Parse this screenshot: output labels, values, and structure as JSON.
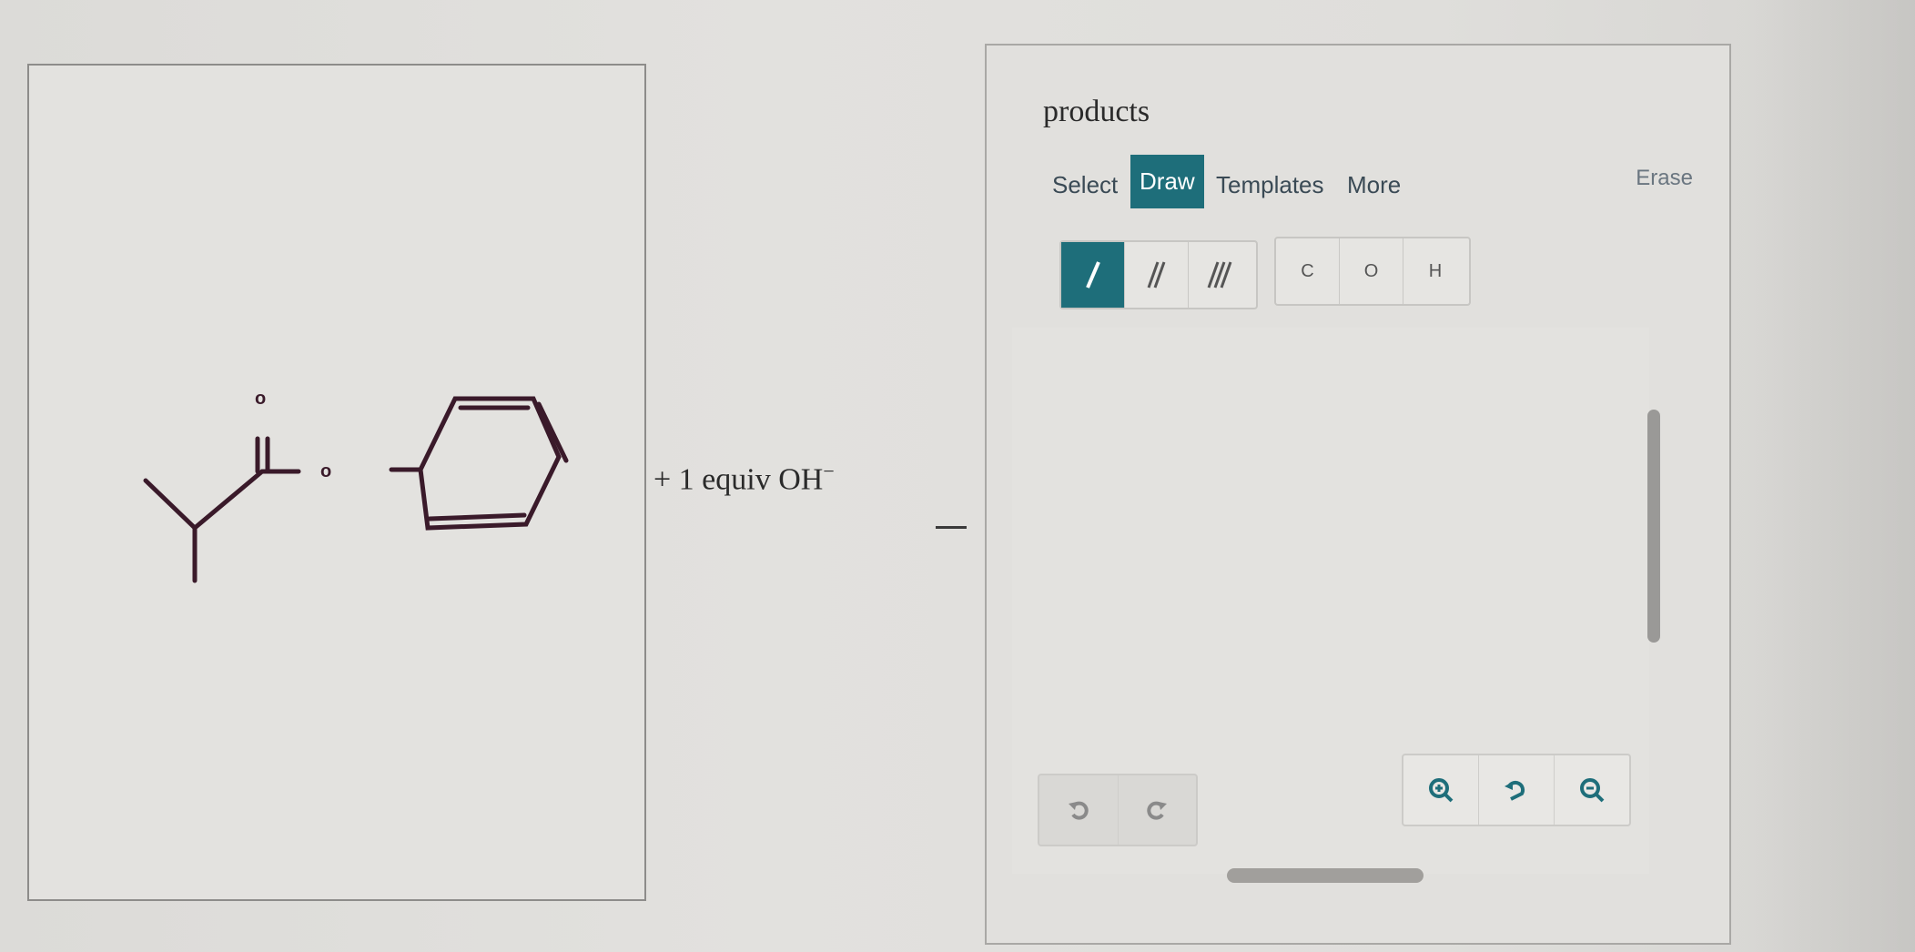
{
  "reaction": {
    "reagent_prefix": "+ 1 equiv OH",
    "reagent_charge": "−",
    "reactant_atoms": {
      "carbonyl_oxygen": "o",
      "ester_oxygen": "o"
    }
  },
  "products": {
    "title": "products"
  },
  "toolbar": {
    "tabs": [
      {
        "label": "Select"
      },
      {
        "label": "Draw"
      },
      {
        "label": "Templates"
      },
      {
        "label": "More"
      }
    ],
    "erase_label": "Erase"
  },
  "atoms": {
    "carbon": "C",
    "oxygen": "O",
    "hydrogen": "H"
  },
  "bond_tools": [
    "single-bond",
    "double-bond",
    "triple-bond"
  ],
  "colors": {
    "accent": "#1e6e7a",
    "bond": "#3a1a2a"
  }
}
